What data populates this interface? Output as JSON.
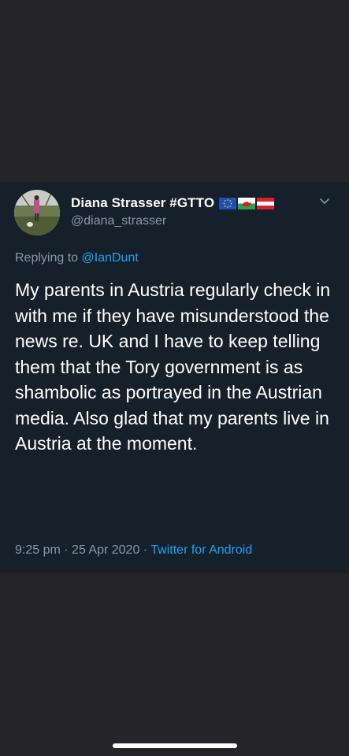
{
  "tweet": {
    "display_name": "Diana Strasser #GTTO",
    "handle": "@diana_strasser",
    "flags": [
      "eu-flag",
      "wales-flag",
      "austria-flag"
    ],
    "replying_prefix": "Replying to",
    "replying_to": "@IanDunt",
    "text": "My parents in Austria regularly check in with me if they have misunderstood the news re. UK and I have to keep telling them that the Tory government is as shambolic as portrayed in the Austrian media. Also glad that my parents live in Austria at the moment.",
    "time": "9:25 pm",
    "separator": "·",
    "date": "25 Apr 2020",
    "source": "Twitter for Android"
  },
  "colors": {
    "page_background": "#252527",
    "card_background": "#15202b",
    "primary_text": "#ffffff",
    "secondary_text": "#8899a6",
    "link": "#1da1f2"
  }
}
